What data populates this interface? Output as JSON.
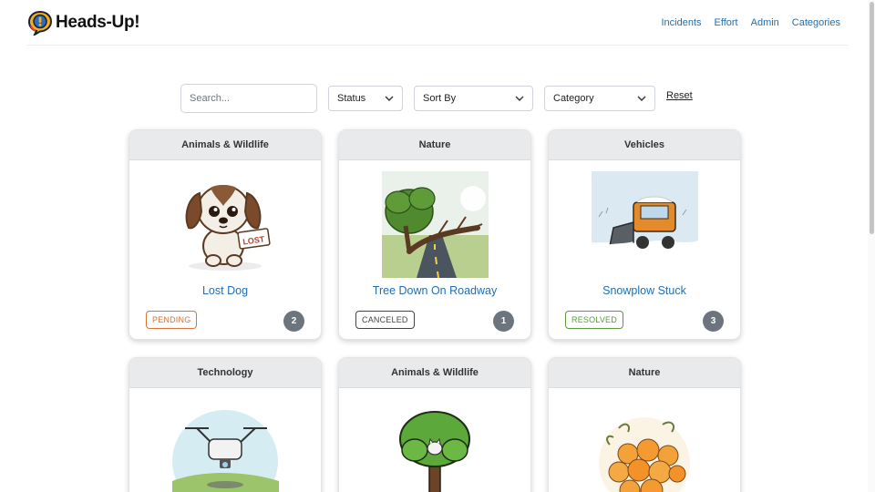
{
  "brand": {
    "name": "Heads-Up!"
  },
  "nav": {
    "links": [
      "Incidents",
      "Effort",
      "Admin",
      "Categories"
    ]
  },
  "filters": {
    "search_placeholder": "Search...",
    "status_label": "Status",
    "sort_label": "Sort By",
    "category_label": "Category",
    "reset_label": "Reset"
  },
  "colors": {
    "link": "#1f6fb2",
    "pending": "#d9733a",
    "canceled": "#444444",
    "resolved": "#5a9a3a",
    "count_badge": "#6c757d"
  },
  "cards": [
    {
      "category": "Animals & Wildlife",
      "title": "Lost Dog",
      "status": "PENDING",
      "count": "2",
      "image": "lost-dog-illustration",
      "sign_text": "LOST"
    },
    {
      "category": "Nature",
      "title": "Tree Down On Roadway",
      "status": "CANCELED",
      "count": "1",
      "image": "fallen-tree-illustration"
    },
    {
      "category": "Vehicles",
      "title": "Snowplow Stuck",
      "status": "RESOLVED",
      "count": "3",
      "image": "snowplow-illustration"
    },
    {
      "category": "Technology",
      "title": "",
      "status": "",
      "count": "",
      "image": "drone-illustration"
    },
    {
      "category": "Animals & Wildlife",
      "title": "",
      "status": "",
      "count": "",
      "image": "cat-in-tree-illustration"
    },
    {
      "category": "Nature",
      "title": "",
      "status": "",
      "count": "",
      "image": "pumpkins-illustration"
    }
  ]
}
